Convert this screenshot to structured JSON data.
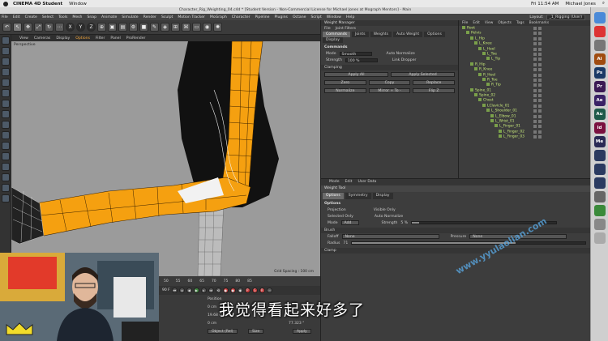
{
  "colors": {
    "accent": "#f7a83b",
    "bone": "#c7e87a",
    "arm_orange": "#f5a010"
  },
  "mac_menubar": {
    "app_name": "CINEMA 4D Student",
    "window_menu": "Window",
    "clock": "Fri 11:54 AM",
    "user": "Michael Jones"
  },
  "window_title": "Character_Rig_Weighting_04.c4d * [Student Version - Non-Commercial License for Michael Jones at Mograph Mentors] - Main",
  "c4d_menu": [
    "File",
    "Edit",
    "Create",
    "Select",
    "Tools",
    "Mesh",
    "Snap",
    "Animate",
    "Simulate",
    "Render",
    "Sculpt",
    "Motion Tracker",
    "MoGraph",
    "Character",
    "Pipeline",
    "Plugins",
    "Octane",
    "Script",
    "Window",
    "Help"
  ],
  "layout": {
    "label": "Layout:",
    "value": "_1_Rigging (User)"
  },
  "toolbar": {
    "axis": [
      "X",
      "Y",
      "Z"
    ]
  },
  "viewport_menu": {
    "items": [
      "View",
      "Cameras",
      "Display",
      "Options",
      "Filter",
      "Panel",
      "ProRender"
    ],
    "active": "Options"
  },
  "viewport": {
    "camera": "Perspective",
    "grid_spacing": "Grid Spacing : 100 cm"
  },
  "weight_manager": {
    "title": "Weight Manager",
    "sub_menu": [
      "File",
      "Joint Filters"
    ],
    "tabs": [
      "Commands",
      "Joints",
      "Weights",
      "Auto Weight",
      "Options"
    ],
    "active_tab": "Commands",
    "display_label": "Display",
    "section": "Commands",
    "mode_label": "Mode",
    "mode_value": "Smooth",
    "auto_normalize": "Auto Normalize",
    "strength_label": "Strength",
    "strength_value": "100 %",
    "link_dropper": "Link Dropper",
    "clamping": "Clamping",
    "apply_all": "Apply All",
    "apply_selected": "Apply Selected",
    "buttons_row1": [
      "Zero",
      "Copy",
      "Replace"
    ],
    "buttons_row2": [
      "Normalize",
      "Mirror + To -",
      "Flip Z"
    ]
  },
  "object_manager": {
    "menu": [
      "File",
      "Edit",
      "View",
      "Objects",
      "Tags",
      "Bookmarks"
    ],
    "rows": [
      {
        "name": "Root",
        "indent": 0
      },
      {
        "name": "Pelvis",
        "indent": 1
      },
      {
        "name": "L_Hip",
        "indent": 2
      },
      {
        "name": "L_Knee",
        "indent": 3
      },
      {
        "name": "L_Heel",
        "indent": 4
      },
      {
        "name": "L_Toe",
        "indent": 5
      },
      {
        "name": "L_Tip",
        "indent": 6
      },
      {
        "name": "R_Hip",
        "indent": 2
      },
      {
        "name": "R_Knee",
        "indent": 3
      },
      {
        "name": "R_Heel",
        "indent": 4
      },
      {
        "name": "R_Toe",
        "indent": 5
      },
      {
        "name": "R_Tip",
        "indent": 6
      },
      {
        "name": "Spine_01",
        "indent": 2
      },
      {
        "name": "Spine_02",
        "indent": 3
      },
      {
        "name": "Chest",
        "indent": 4
      },
      {
        "name": "LClavicle_01",
        "indent": 5
      },
      {
        "name": "L_Shoulder_01",
        "indent": 6
      },
      {
        "name": "L_Elbow_01",
        "indent": 7
      },
      {
        "name": "L_Wrist_01",
        "indent": 7
      },
      {
        "name": "L_Finger_01",
        "indent": 8
      },
      {
        "name": "L_Finger_02",
        "indent": 9
      },
      {
        "name": "L_Finger_03",
        "indent": 9
      }
    ]
  },
  "attributes": {
    "menu": [
      "Mode",
      "Edit",
      "User Data"
    ],
    "title": "Weight Tool",
    "tabs": [
      "Options",
      "Symmetry",
      "Display"
    ],
    "active_tab": "Options",
    "section": "Options",
    "projection": "Projection",
    "visible_only": "Visible Only",
    "selected_only": "Selected Only",
    "auto_normalize": "Auto Normalize",
    "mode_label": "Mode",
    "mode_value": "Add",
    "strength_label": "Strength",
    "strength_value": "5 %",
    "strength_fraction": 0.05,
    "brush": "Brush",
    "falloff_label": "Falloff",
    "falloff_value": "None",
    "pressure_label": "Pressure",
    "pressure_value": "None",
    "radius_label": "Radius",
    "radius_value": "71",
    "radius_fraction": 0.7,
    "clamp": "Clamp"
  },
  "timeline": {
    "ticks": [
      "50",
      "55",
      "60",
      "65",
      "70",
      "75",
      "80",
      "85"
    ],
    "frame": "0 F",
    "end": "90 F"
  },
  "coordinates": {
    "position": "Position",
    "x": "0 cm",
    "y": "19.68 cm",
    "z": "0 cm",
    "angle_b": "77.323 °",
    "object_label": "Object (Rel)",
    "size_label": "Size",
    "apply": "Apply"
  },
  "dock_icons": [
    {
      "name": "finder-icon",
      "label": "",
      "color": "#4a8ad8"
    },
    {
      "name": "chrome-icon",
      "label": "",
      "color": "#d33"
    },
    {
      "name": "sync-icon",
      "label": "",
      "color": "#777"
    },
    {
      "name": "illustrator-icon",
      "label": "Ai",
      "color": "#a04c10"
    },
    {
      "name": "photoshop-icon",
      "label": "Ps",
      "color": "#1b3a66"
    },
    {
      "name": "premiere-icon",
      "label": "Pr",
      "color": "#3b1a55"
    },
    {
      "name": "aftereffects-icon",
      "label": "Ae",
      "color": "#3a2266"
    },
    {
      "name": "audition-icon",
      "label": "Au",
      "color": "#1e5a4a"
    },
    {
      "name": "indesign-icon",
      "label": "Id",
      "color": "#7a1040"
    },
    {
      "name": "media-encoder-icon",
      "label": "Me",
      "color": "#2a2a55"
    },
    {
      "name": "cinema4d-icon",
      "label": "",
      "color": "#2a3a60"
    },
    {
      "name": "cinema4d-r2-icon",
      "label": "",
      "color": "#2a3a60"
    },
    {
      "name": "cinema4d-r3-icon",
      "label": "",
      "color": "#2a3a60"
    },
    {
      "name": "bridge-icon",
      "label": "",
      "color": "#666"
    },
    {
      "name": "messages-icon",
      "label": "",
      "color": "#3a8a3a"
    },
    {
      "name": "preview-icon",
      "label": "",
      "color": "#888"
    },
    {
      "name": "trash-icon",
      "label": "",
      "color": "#aaa"
    }
  ],
  "subtitle": "我觉得看起来好多了",
  "watermark": "www.yyulaolian.com"
}
